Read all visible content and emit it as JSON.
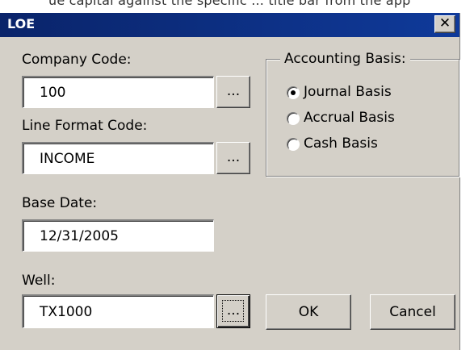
{
  "top_strip_text": "ue capital against the specific ... title bar from the app",
  "window": {
    "title": "LOE",
    "close_glyph": "✕"
  },
  "company_code": {
    "label": "Company Code:",
    "value": "100",
    "browse_label": "..."
  },
  "line_format_code": {
    "label": "Line Format Code:",
    "value": "INCOME",
    "browse_label": "..."
  },
  "base_date": {
    "label": "Base Date:",
    "value": "12/31/2005"
  },
  "well": {
    "label": "Well:",
    "value": "TX1000",
    "browse_label": "..."
  },
  "accounting_basis": {
    "title": "Accounting Basis:",
    "options": [
      {
        "label": "Journal Basis",
        "selected": true
      },
      {
        "label": "Accrual Basis",
        "selected": false
      },
      {
        "label": "Cash Basis",
        "selected": false
      }
    ]
  },
  "buttons": {
    "ok": "OK",
    "cancel": "Cancel"
  },
  "colors": {
    "titlebar": "#0a246a",
    "dialog_bg": "#d4d0c8",
    "title_text": "#ffffff"
  }
}
